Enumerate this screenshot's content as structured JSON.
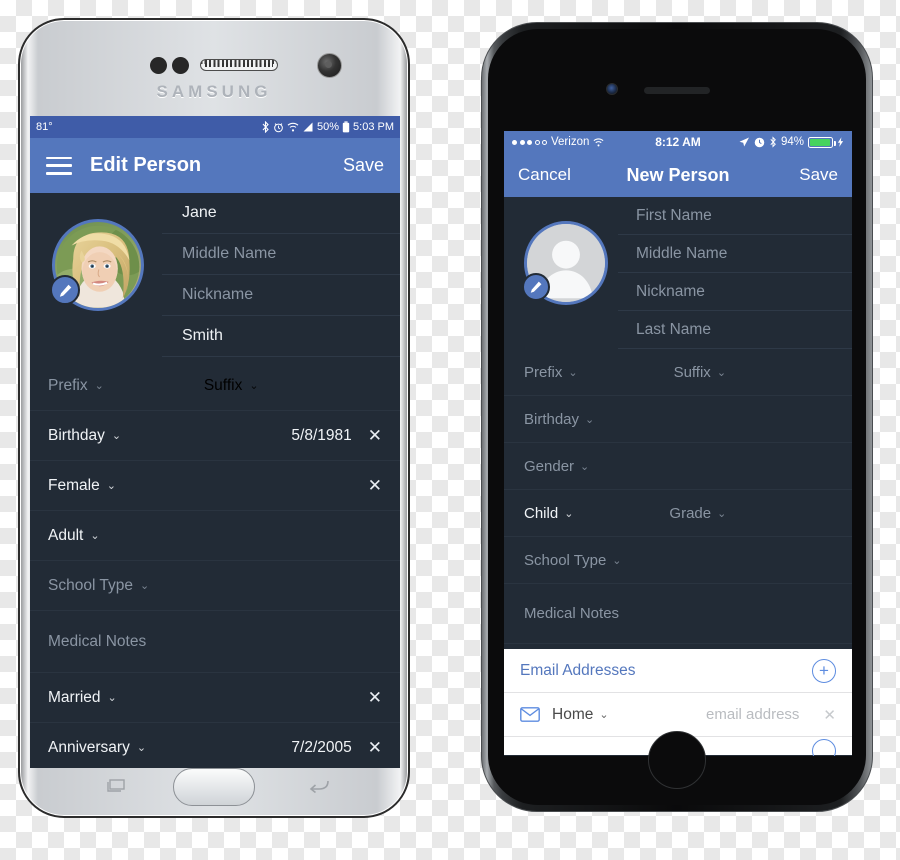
{
  "android": {
    "brand": "SAMSUNG",
    "status_bar": {
      "temperature": "81°",
      "battery": "50%",
      "time": "5:03 PM",
      "icons": [
        "bluetooth-icon",
        "alarm-icon",
        "wifi-icon",
        "signal-icon",
        "battery-icon"
      ]
    },
    "app_bar": {
      "menu_icon": "hamburger-menu-icon",
      "title": "Edit Person",
      "save_label": "Save"
    },
    "avatar": {
      "edit_icon": "pencil-icon",
      "photo": "woman-profile-photo"
    },
    "name_fields": [
      {
        "text": "Jane",
        "filled": true
      },
      {
        "text": "Middle Name",
        "filled": false
      },
      {
        "text": "Nickname",
        "filled": false
      },
      {
        "text": "Smith",
        "filled": true
      }
    ],
    "rows": [
      {
        "label": "Prefix",
        "second": "Suffix",
        "filled": false,
        "caret": true,
        "value": "",
        "clear": false
      },
      {
        "label": "Birthday",
        "second": "",
        "filled": true,
        "caret": true,
        "value": "5/8/1981",
        "clear": true
      },
      {
        "label": "Female",
        "second": "",
        "filled": true,
        "caret": true,
        "value": "",
        "clear": true
      },
      {
        "label": "Adult",
        "second": "",
        "filled": true,
        "caret": true,
        "value": "",
        "clear": false
      },
      {
        "label": "School Type",
        "second": "",
        "filled": false,
        "caret": true,
        "value": "",
        "clear": false
      },
      {
        "label": "Medical Notes",
        "second": "",
        "filled": false,
        "caret": false,
        "value": "",
        "clear": false
      },
      {
        "label": "Married",
        "second": "",
        "filled": true,
        "caret": true,
        "value": "",
        "clear": true
      },
      {
        "label": "Anniversary",
        "second": "",
        "filled": true,
        "caret": true,
        "value": "7/2/2005",
        "clear": true
      }
    ],
    "nav": {
      "recents_icon": "recents-icon",
      "home_icon": "home-button",
      "back_icon": "back-icon"
    }
  },
  "iphone": {
    "status_bar": {
      "carrier": "Verizon",
      "time": "8:12 AM",
      "battery": "94%",
      "icons": [
        "location-icon",
        "alarm-icon",
        "bluetooth-icon",
        "battery-icon",
        "charging-bolt-icon"
      ]
    },
    "nav_bar": {
      "cancel_label": "Cancel",
      "title": "New Person",
      "save_label": "Save"
    },
    "avatar": {
      "edit_icon": "pencil-icon",
      "photo": "default-person-silhouette"
    },
    "name_fields": [
      {
        "text": "First Name"
      },
      {
        "text": "Middle Name"
      },
      {
        "text": "Nickname"
      },
      {
        "text": "Last Name"
      }
    ],
    "rows": [
      {
        "label": "Prefix",
        "second": "Suffix",
        "filled": false,
        "caret": true,
        "second_caret": true
      },
      {
        "label": "Birthday",
        "second": "",
        "filled": false,
        "caret": true,
        "second_caret": false
      },
      {
        "label": "Gender",
        "second": "",
        "filled": false,
        "caret": true,
        "second_caret": false
      },
      {
        "label": "Child",
        "second": "Grade",
        "filled": true,
        "caret": true,
        "second_caret": true
      },
      {
        "label": "School Type",
        "second": "",
        "filled": false,
        "caret": true,
        "second_caret": false
      },
      {
        "label": "Medical Notes",
        "second": "",
        "filled": false,
        "caret": false,
        "second_caret": false
      }
    ],
    "email_section": {
      "title": "Email Addresses",
      "add_icon": "plus-icon",
      "row": {
        "icon": "envelope-icon",
        "type": "Home",
        "placeholder": "email address",
        "clear_icon": "close-icon"
      }
    },
    "home_button": "home-button"
  },
  "colors": {
    "header_blue": "#5477bd",
    "status_blue": "#3f5ca8",
    "dark_bg": "#222b36",
    "divider": "#2a3440",
    "placeholder_text": "#8a95a3",
    "filled_text": "#f0f3f6",
    "link_blue": "#5d8ce0",
    "battery_green": "#46d35e"
  }
}
